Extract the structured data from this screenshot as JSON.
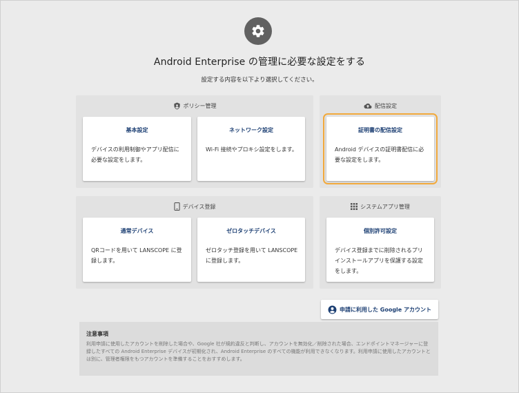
{
  "header": {
    "title": "Android Enterprise の管理に必要な設定をする",
    "subtitle": "設定する内容を以下より選択してください。"
  },
  "groups": {
    "policy": {
      "label": "ポリシー管理",
      "cards": [
        {
          "title": "基本設定",
          "desc": "デバイスの利用制御やアプリ配信に必要な設定をします。"
        },
        {
          "title": "ネットワーク設定",
          "desc": "Wi-Fi 接続やプロキシ設定をします。"
        }
      ]
    },
    "delivery": {
      "label": "配信設定",
      "cards": [
        {
          "title": "証明書の配信設定",
          "desc": "Android デバイスの証明書配信に必要な設定をします。"
        }
      ]
    },
    "device": {
      "label": "デバイス登録",
      "cards": [
        {
          "title": "通常デバイス",
          "desc": "QRコードを用いて LANSCOPE に登録します。"
        },
        {
          "title": "ゼロタッチデバイス",
          "desc": "ゼロタッチ登録を用いて LANSCOPE に登録します。"
        }
      ]
    },
    "sysapp": {
      "label": "システムアプリ管理",
      "cards": [
        {
          "title": "個別許可設定",
          "desc": "デバイス登録までに削除されるプリインストールアプリを保護する設定をします。"
        }
      ]
    }
  },
  "google_button": {
    "label": "申請に利用した Google アカウント"
  },
  "notice": {
    "title": "注意事項",
    "body": "利用申請に使用したアカウントを削除した場合や、Google 社が規約違反と判断し、アカウントを無効化／削除された場合、エンドポイントマネージャーに登録したすべての Android Enterprise デバイスが初期化され、Android Enterprise のすべての機能が利用できなくなります。利用申請に使用したアカウントとは別に、管理者権限をもつアカウントを準備することをおすすめします。"
  },
  "colors": {
    "accent": "#1c3f73",
    "selected_outline": "#f2a93b",
    "gear_bg": "#616161"
  }
}
